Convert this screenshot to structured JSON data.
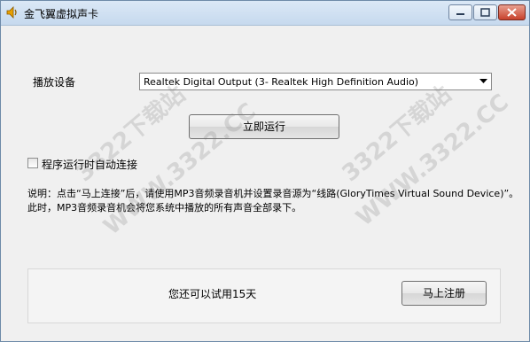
{
  "window": {
    "title": "金飞翼虚拟声卡"
  },
  "device": {
    "label": "播放设备",
    "selected": "Realtek Digital Output (3- Realtek High Definition Audio)"
  },
  "run_button": "立即运行",
  "autoconnect": {
    "label": "程序运行时自动连接",
    "checked": false
  },
  "note": {
    "line1": "说明：点击“马上连接”后，请使用MP3音频录音机并设置录音源为“线路(GloryTimes Virtual Sound Device)”。",
    "line2": "此时，MP3音频录音机会将您系统中播放的所有声音全部录下。"
  },
  "trial": {
    "text": "您还可以试用15天",
    "register_button": "马上注册"
  },
  "watermarks": [
    "3322下载站",
    "WWW.3322.CC",
    "3322下载站",
    "WWW.3322.CC"
  ],
  "colors": {
    "title_bar": "#c6d9ee",
    "close_button": "#c8412c",
    "window_bg": "#f0f0f0"
  }
}
